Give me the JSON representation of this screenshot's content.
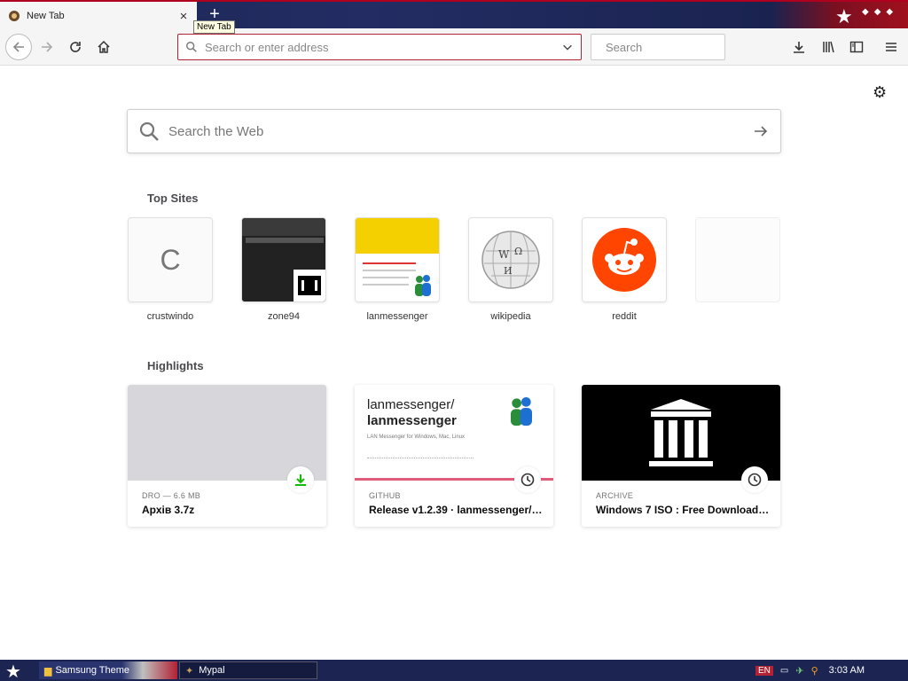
{
  "tab": {
    "title": "New Tab",
    "close": "×"
  },
  "tooltip": "New Tab",
  "newtab_symbol": "+",
  "toolbar": {
    "url_placeholder": "Search or enter address",
    "search_placeholder": "Search"
  },
  "page": {
    "search_placeholder": "Search the Web",
    "top_sites_heading": "Top Sites",
    "highlights_heading": "Highlights"
  },
  "top_sites": [
    {
      "label": "crustwindo",
      "letter": "C"
    },
    {
      "label": "zone94"
    },
    {
      "label": "lanmessenger"
    },
    {
      "label": "wikipedia"
    },
    {
      "label": "reddit"
    }
  ],
  "highlights": [
    {
      "meta": "DRO — 6.6 MB",
      "title": "Архів 3.7z"
    },
    {
      "meta": "GITHUB",
      "title": "Release v1.2.39 · lanmessenger/l...",
      "img_title_1": "lanmessenger/",
      "img_title_2": "lanmessenger",
      "img_sub": "LAN Messenger for Windows, Mac, Linux"
    },
    {
      "meta": "ARCHIVE",
      "title": "Windows 7 ISO : Free Download...."
    }
  ],
  "taskbar": {
    "item1": "Samsung Theme",
    "item2": "Mypal",
    "lang": "EN",
    "time": "3:03 AM"
  },
  "colors": {
    "accent_red": "#b22234",
    "reddit": "#ff4500",
    "download_green": "#12bc00",
    "taskbar": "#1c2552"
  }
}
